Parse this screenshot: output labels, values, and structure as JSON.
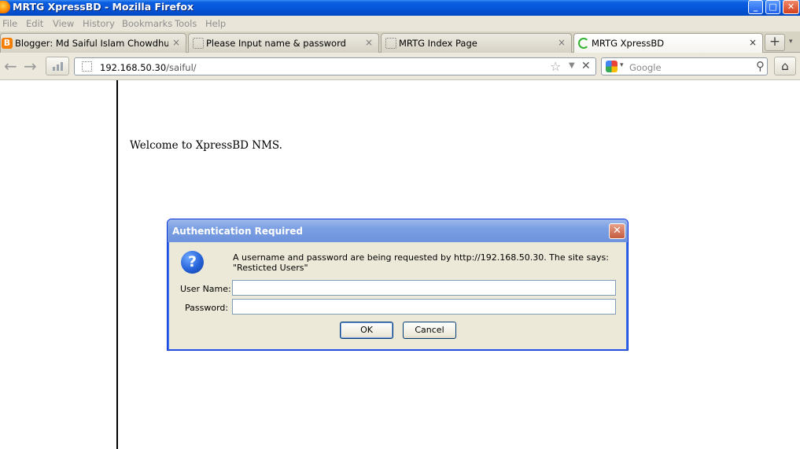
{
  "window": {
    "title": "MRTG XpressBD - Mozilla Firefox",
    "controls": {
      "minimize": "_",
      "maximize": "□",
      "close": "✕"
    }
  },
  "menu": [
    "File",
    "Edit",
    "View",
    "History",
    "Bookmarks",
    "Tools",
    "Help"
  ],
  "tabs": [
    {
      "label": "Blogger: Md Saiful Islam Chowdhury - P...",
      "icon": "blogger-icon",
      "active": false
    },
    {
      "label": "Please Input name & password",
      "icon": "page-icon",
      "active": false
    },
    {
      "label": "MRTG Index Page",
      "icon": "page-icon",
      "active": false
    },
    {
      "label": "MRTG XpressBD",
      "icon": "loading-icon",
      "active": true
    }
  ],
  "tab_close_glyph": "×",
  "new_tab_glyph": "+",
  "navbar": {
    "back_glyph": "←",
    "forward_glyph": "→",
    "url_host": "192.168.50.30",
    "url_path": "/saiful/",
    "star_glyph": "☆",
    "drop_glyph": "▼",
    "stop_glyph": "✕"
  },
  "search": {
    "placeholder": "Google",
    "drop_glyph": "▾",
    "magnifier_glyph": "⚲"
  },
  "home_glyph": "⌂",
  "page": {
    "welcome": "Welcome to XpressBD NMS."
  },
  "dialog": {
    "title": "Authentication Required",
    "close_glyph": "✕",
    "icon_glyph": "?",
    "message": "A username and password are being requested by http://192.168.50.30. The site says: \"Resticted Users\"",
    "username_label": "User Name:",
    "username_value": "",
    "password_label": "Password:",
    "password_value": "",
    "ok_label": "OK",
    "cancel_label": "Cancel"
  },
  "colors": {
    "titlebar": "#0554d6",
    "dialog_titlebar": "#7b9fe3",
    "dialog_background": "#ece9d8",
    "menu_background": "#e9e6d9"
  }
}
